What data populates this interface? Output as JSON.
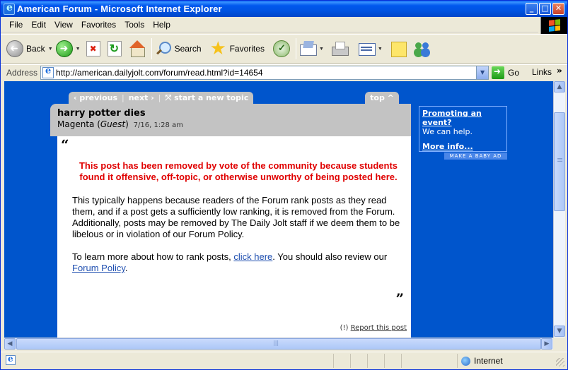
{
  "window": {
    "title": "American Forum - Microsoft Internet Explorer",
    "minimize": "_",
    "maximize": "□",
    "close": "✕"
  },
  "menu": [
    "File",
    "Edit",
    "View",
    "Favorites",
    "Tools",
    "Help"
  ],
  "toolbar": {
    "back_label": "Back",
    "search_label": "Search",
    "favorites_label": "Favorites"
  },
  "address": {
    "label": "Address",
    "url": "http://american.dailyjolt.com/forum/read.html?id=14654",
    "go_label": "Go",
    "links_label": "Links"
  },
  "forum": {
    "nav": {
      "previous": "‹ previous",
      "next": "next ›",
      "new_topic": "⤧ start a new topic",
      "top": "top ^"
    },
    "post": {
      "title": "harry potter dies",
      "author": "Magenta",
      "author_role": "Guest",
      "timestamp": "7/16, 1:28 am",
      "quote_open": "“",
      "quote_close": "”",
      "removed_notice": "This post has been removed by vote of the community because students found it offensive, off-topic, or otherwise unworthy of being posted here.",
      "explanation": "This typically happens because readers of the Forum rank posts as they read them, and if a post gets a sufficiently low ranking, it is removed from the Forum. Additionally, posts may be removed by The Daily Jolt staff if we deem them to be libelous or in violation of our Forum Policy.",
      "learn_prefix": "To learn more about how to rank posts, ",
      "click_here": "click here",
      "learn_middle": ". You should also review our ",
      "forum_policy": "Forum Policy",
      "learn_suffix": ".",
      "report_prefix": "(!) ",
      "report_link": "Report this post"
    },
    "ad": {
      "headline": "Promoting an event?",
      "text": "We can help.",
      "more": "More info...",
      "footer": "MAKE A BABY AD"
    }
  },
  "status": {
    "zone": "Internet"
  },
  "colors": {
    "page_background": "#0055cc",
    "removed_text": "#e00000",
    "header_gray": "#c3c3c3"
  }
}
